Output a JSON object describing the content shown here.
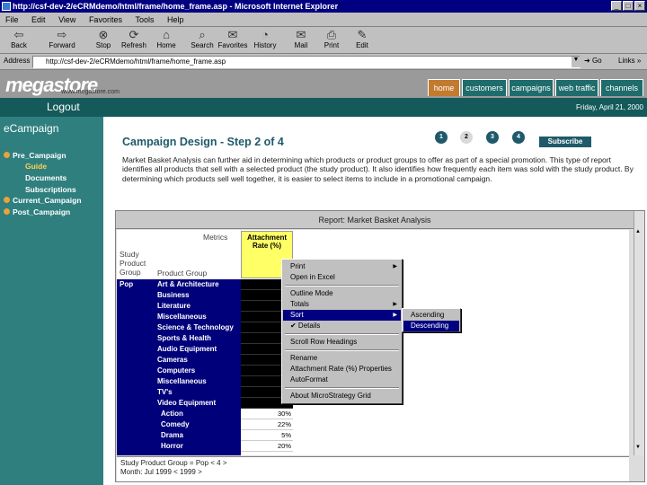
{
  "window": {
    "title": "http://csf-dev-2/eCRMdemo/html/frame/home_frame.asp - Microsoft Internet Explorer",
    "controls": [
      "_",
      "□",
      "×"
    ]
  },
  "menu": [
    "File",
    "Edit",
    "View",
    "Favorites",
    "Tools",
    "Help"
  ],
  "toolbar": [
    {
      "label": "Back",
      "icon": "back-arrow-icon"
    },
    {
      "label": "Forward",
      "icon": "forward-arrow-icon"
    },
    {
      "label": "Stop",
      "icon": "stop-icon"
    },
    {
      "label": "Refresh",
      "icon": "refresh-icon"
    },
    {
      "label": "Home",
      "icon": "home-icon"
    },
    {
      "label": "Search",
      "icon": "search-icon"
    },
    {
      "label": "Favorites",
      "icon": "favorites-icon"
    },
    {
      "label": "History",
      "icon": "history-icon"
    },
    {
      "label": "Mail",
      "icon": "mail-icon"
    },
    {
      "label": "Print",
      "icon": "print-icon"
    },
    {
      "label": "Edit",
      "icon": "edit-icon"
    }
  ],
  "address": {
    "label": "Address",
    "url": "http://csf-dev-2/eCRMdemo/html/frame/home_frame.asp",
    "go": "Go",
    "links": "Links »"
  },
  "site": {
    "logo": "megastore",
    "logo_sub": "www.megastore.com",
    "nav": [
      "home",
      "customers",
      "campaigns",
      "web traffic",
      "channels"
    ],
    "active_nav": "home",
    "logout": "Logout",
    "date": "Friday, April 21, 2000"
  },
  "sidebar": {
    "title": "eCampaign",
    "items": [
      {
        "label": "Pre_Campaign"
      },
      {
        "label": "Guide",
        "current": true
      },
      {
        "label": "Documents"
      },
      {
        "label": "Subscriptions"
      },
      {
        "label": "Current_Campaign"
      },
      {
        "label": "Post_Campaign"
      }
    ]
  },
  "main": {
    "heading": "Campaign Design - Step 2 of 4",
    "steps": [
      "1",
      "2",
      "3",
      "4"
    ],
    "current_step": 2,
    "subscribe": "Subscribe",
    "description": "Market Basket Analysis can further aid in determining which products or product groups to offer as part of a special promotion. This type of report identifies all products that sell with a selected product (the study product). It also identifies how frequently each item was sold with the study product. By determining which products sell well together, it is easier to select items to include in a promotional campaign."
  },
  "report": {
    "title": "Report: Market Basket Analysis",
    "metrics_label": "Metrics",
    "col_header": "Attachment Rate (%)",
    "row_header_1": "Study Product Group",
    "row_header_2": "Product Group",
    "group": "Pop",
    "rows": [
      {
        "label": "Art & Architecture",
        "value": ""
      },
      {
        "label": "Business",
        "value": ""
      },
      {
        "label": "Literature",
        "value": ""
      },
      {
        "label": "Miscellaneous",
        "value": ""
      },
      {
        "label": "Science & Technology",
        "value": ""
      },
      {
        "label": "Sports & Health",
        "value": ""
      },
      {
        "label": "Audio Equipment",
        "value": ""
      },
      {
        "label": "Cameras",
        "value": ""
      },
      {
        "label": "Computers",
        "value": ""
      },
      {
        "label": "Miscellaneous",
        "value": ""
      },
      {
        "label": "TV's",
        "value": ""
      },
      {
        "label": "Video Equipment",
        "value": ""
      },
      {
        "label": "Action",
        "value": "30%"
      },
      {
        "label": "Comedy",
        "value": "22%"
      },
      {
        "label": "Drama",
        "value": "5%"
      },
      {
        "label": "Horror",
        "value": "20%"
      }
    ],
    "footer_line1": "Study Product Group = Pop < 4 >",
    "footer_line2": "Month: Jul 1999 < 1999 >"
  },
  "context_menu": {
    "items": [
      {
        "label": "Print",
        "submenu": true
      },
      {
        "label": "Open in Excel"
      },
      {
        "sep": true
      },
      {
        "label": "Outline Mode"
      },
      {
        "label": "Totals",
        "submenu": true
      },
      {
        "label": "Sort",
        "submenu": true,
        "highlight": true
      },
      {
        "label": "✔ Details"
      },
      {
        "sep": true
      },
      {
        "label": "Scroll Row Headings"
      },
      {
        "sep": true
      },
      {
        "label": "Rename"
      },
      {
        "label": "Attachment Rate (%) Properties"
      },
      {
        "label": "AutoFormat"
      },
      {
        "sep": true
      },
      {
        "label": "About MicroStrategy Grid"
      }
    ],
    "sort_submenu": [
      {
        "label": "Ascending"
      },
      {
        "label": "Descending",
        "highlight": true
      }
    ]
  },
  "colors": {
    "titlebar": "#000080",
    "sidebar": "#2f7f7f",
    "accent": "#c27a2e",
    "row_group": "#00007a",
    "highlight_col": "#ffff66"
  }
}
